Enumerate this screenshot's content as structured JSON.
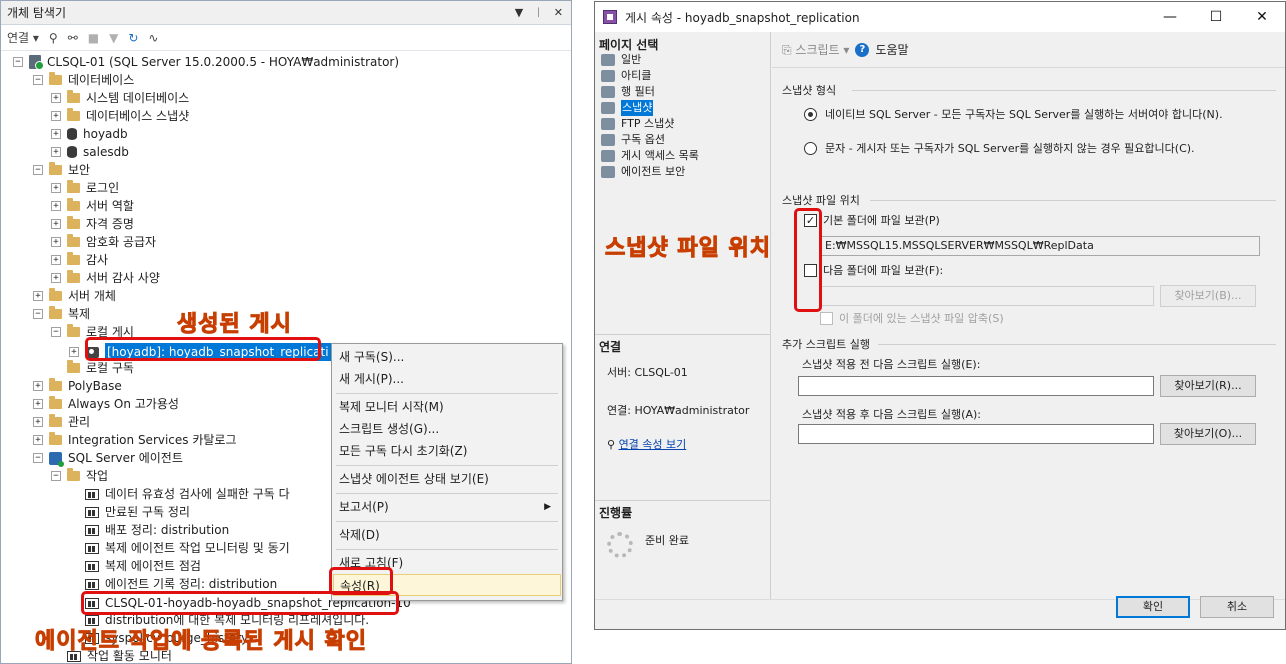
{
  "explorer": {
    "title": "개체 탐색기",
    "title_controls": [
      "▼",
      "ᛁ",
      "✕"
    ],
    "toolbar": {
      "connect": "연결 ▾",
      "icons": [
        "plug-icon",
        "disconnect-icon",
        "stop-icon",
        "filter-icon",
        "refresh-icon",
        "activity-icon"
      ]
    },
    "tree": {
      "server": "CLSQL-01 (SQL Server 15.0.2000.5 - HOYA₩administrator)",
      "databases": "데이터베이스",
      "system_db": "시스템 데이터베이스",
      "db_snapshot": "데이터베이스 스냅샷",
      "hoyadb": "hoyadb",
      "salesdb": "salesdb",
      "security": "보안",
      "login": "로그인",
      "server_roles": "서버 역할",
      "credentials": "자격 증명",
      "crypto": "암호화 공급자",
      "audit": "감사",
      "audit_spec": "서버 감사 사양",
      "server_objects": "서버 개체",
      "replication": "복제",
      "local_pub": "로컬 게시",
      "publication": "[hoyadb]: hoyadb_snapshot_replicati",
      "local_sub": "로컬 구독",
      "polybase": "PolyBase",
      "alwayson": "Always On 고가용성",
      "management": "관리",
      "integration": "Integration Services 카탈로그",
      "agent": "SQL Server 에이전트",
      "jobs": "작업",
      "job1": "데이터 유효성 검사에 실패한 구독 다",
      "job2": "만료된 구독 정리",
      "job3": "배포 정리: distribution",
      "job4": "복제 에이전트 작업 모니터링 및 동기",
      "job5": "복제 에이전트 점검",
      "job6": "에이전트 기록 정리: distribution",
      "job7": "CLSQL-01-hoyadb-hoyadb_snapshot_replication-10",
      "job8": "distribution에 대한 복제 모니터링 리프레셔입니다.",
      "job9": "syspolicy_purge_history",
      "activity": "작업 활동 모니터"
    },
    "context_menu": {
      "new_sub": "새 구독(S)...",
      "new_pub": "새 게시(P)...",
      "monitor": "복제 모니터 시작(M)",
      "script": "스크립트 생성(G)...",
      "reinit": "모든 구독 다시 초기화(Z)",
      "snap_status": "스냅샷 에이전트 상태 보기(E)",
      "reports": "보고서(P)",
      "delete": "삭제(D)",
      "refresh": "새로 고침(F)",
      "properties": "속성(R)"
    },
    "annotations": {
      "created_pub": "생성된 게시",
      "agent_job": "에이전트 작업에 등록된 게시 확인"
    }
  },
  "dialog": {
    "title": "게시 속성 - hoyadb_snapshot_replication",
    "window_controls": [
      "—",
      "☐",
      "✕"
    ],
    "select_page": "페이지 선택",
    "pages": [
      "일반",
      "아티클",
      "행 필터",
      "스냅샷",
      "FTP 스냅샷",
      "구독 옵션",
      "게시 액세스 목록",
      "에이전트 보안"
    ],
    "active_page": "스냅샷",
    "connection_header": "연결",
    "server_label": "서버: CLSQL-01",
    "conn_label": "연결: HOYA₩administrator",
    "view_props": "연결 속성 보기",
    "progress_header": "진행률",
    "ready": "준비 완료",
    "toolbar_script": "스크립트",
    "toolbar_help": "도움말",
    "snapshot_format": "스냅샷 형식",
    "native_option": "네이티브 SQL Server - 모든 구독자는 SQL Server를 실행하는 서버여야 합니다(N).",
    "char_option": "문자 - 게시자 또는 구독자가 SQL Server를 실행하지 않는 경우 필요합니다(C).",
    "file_location": "스냅샷 파일 위치",
    "default_folder": "기본 폴더에 파일 보관(P)",
    "default_path": "E:₩MSSQL15.MSSQLSERVER₩MSSQL₩ReplData",
    "next_folder": "다음 폴더에 파일 보관(F):",
    "browse_b": "찾아보기(B)...",
    "compress": "이 폴더에 있는 스냅샷 파일 압축(S)",
    "extra_scripts": "추가 스크립트 실행",
    "before_script": "스냅샷 적용 전 다음 스크립트 실행(E):",
    "browse_r": "찾아보기(R)...",
    "after_script": "스냅샷 적용 후 다음 스크립트 실행(A):",
    "browse_o": "찾아보기(O)...",
    "ok": "확인",
    "cancel": "취소",
    "annotation": "스냅샷 파일 위치"
  }
}
